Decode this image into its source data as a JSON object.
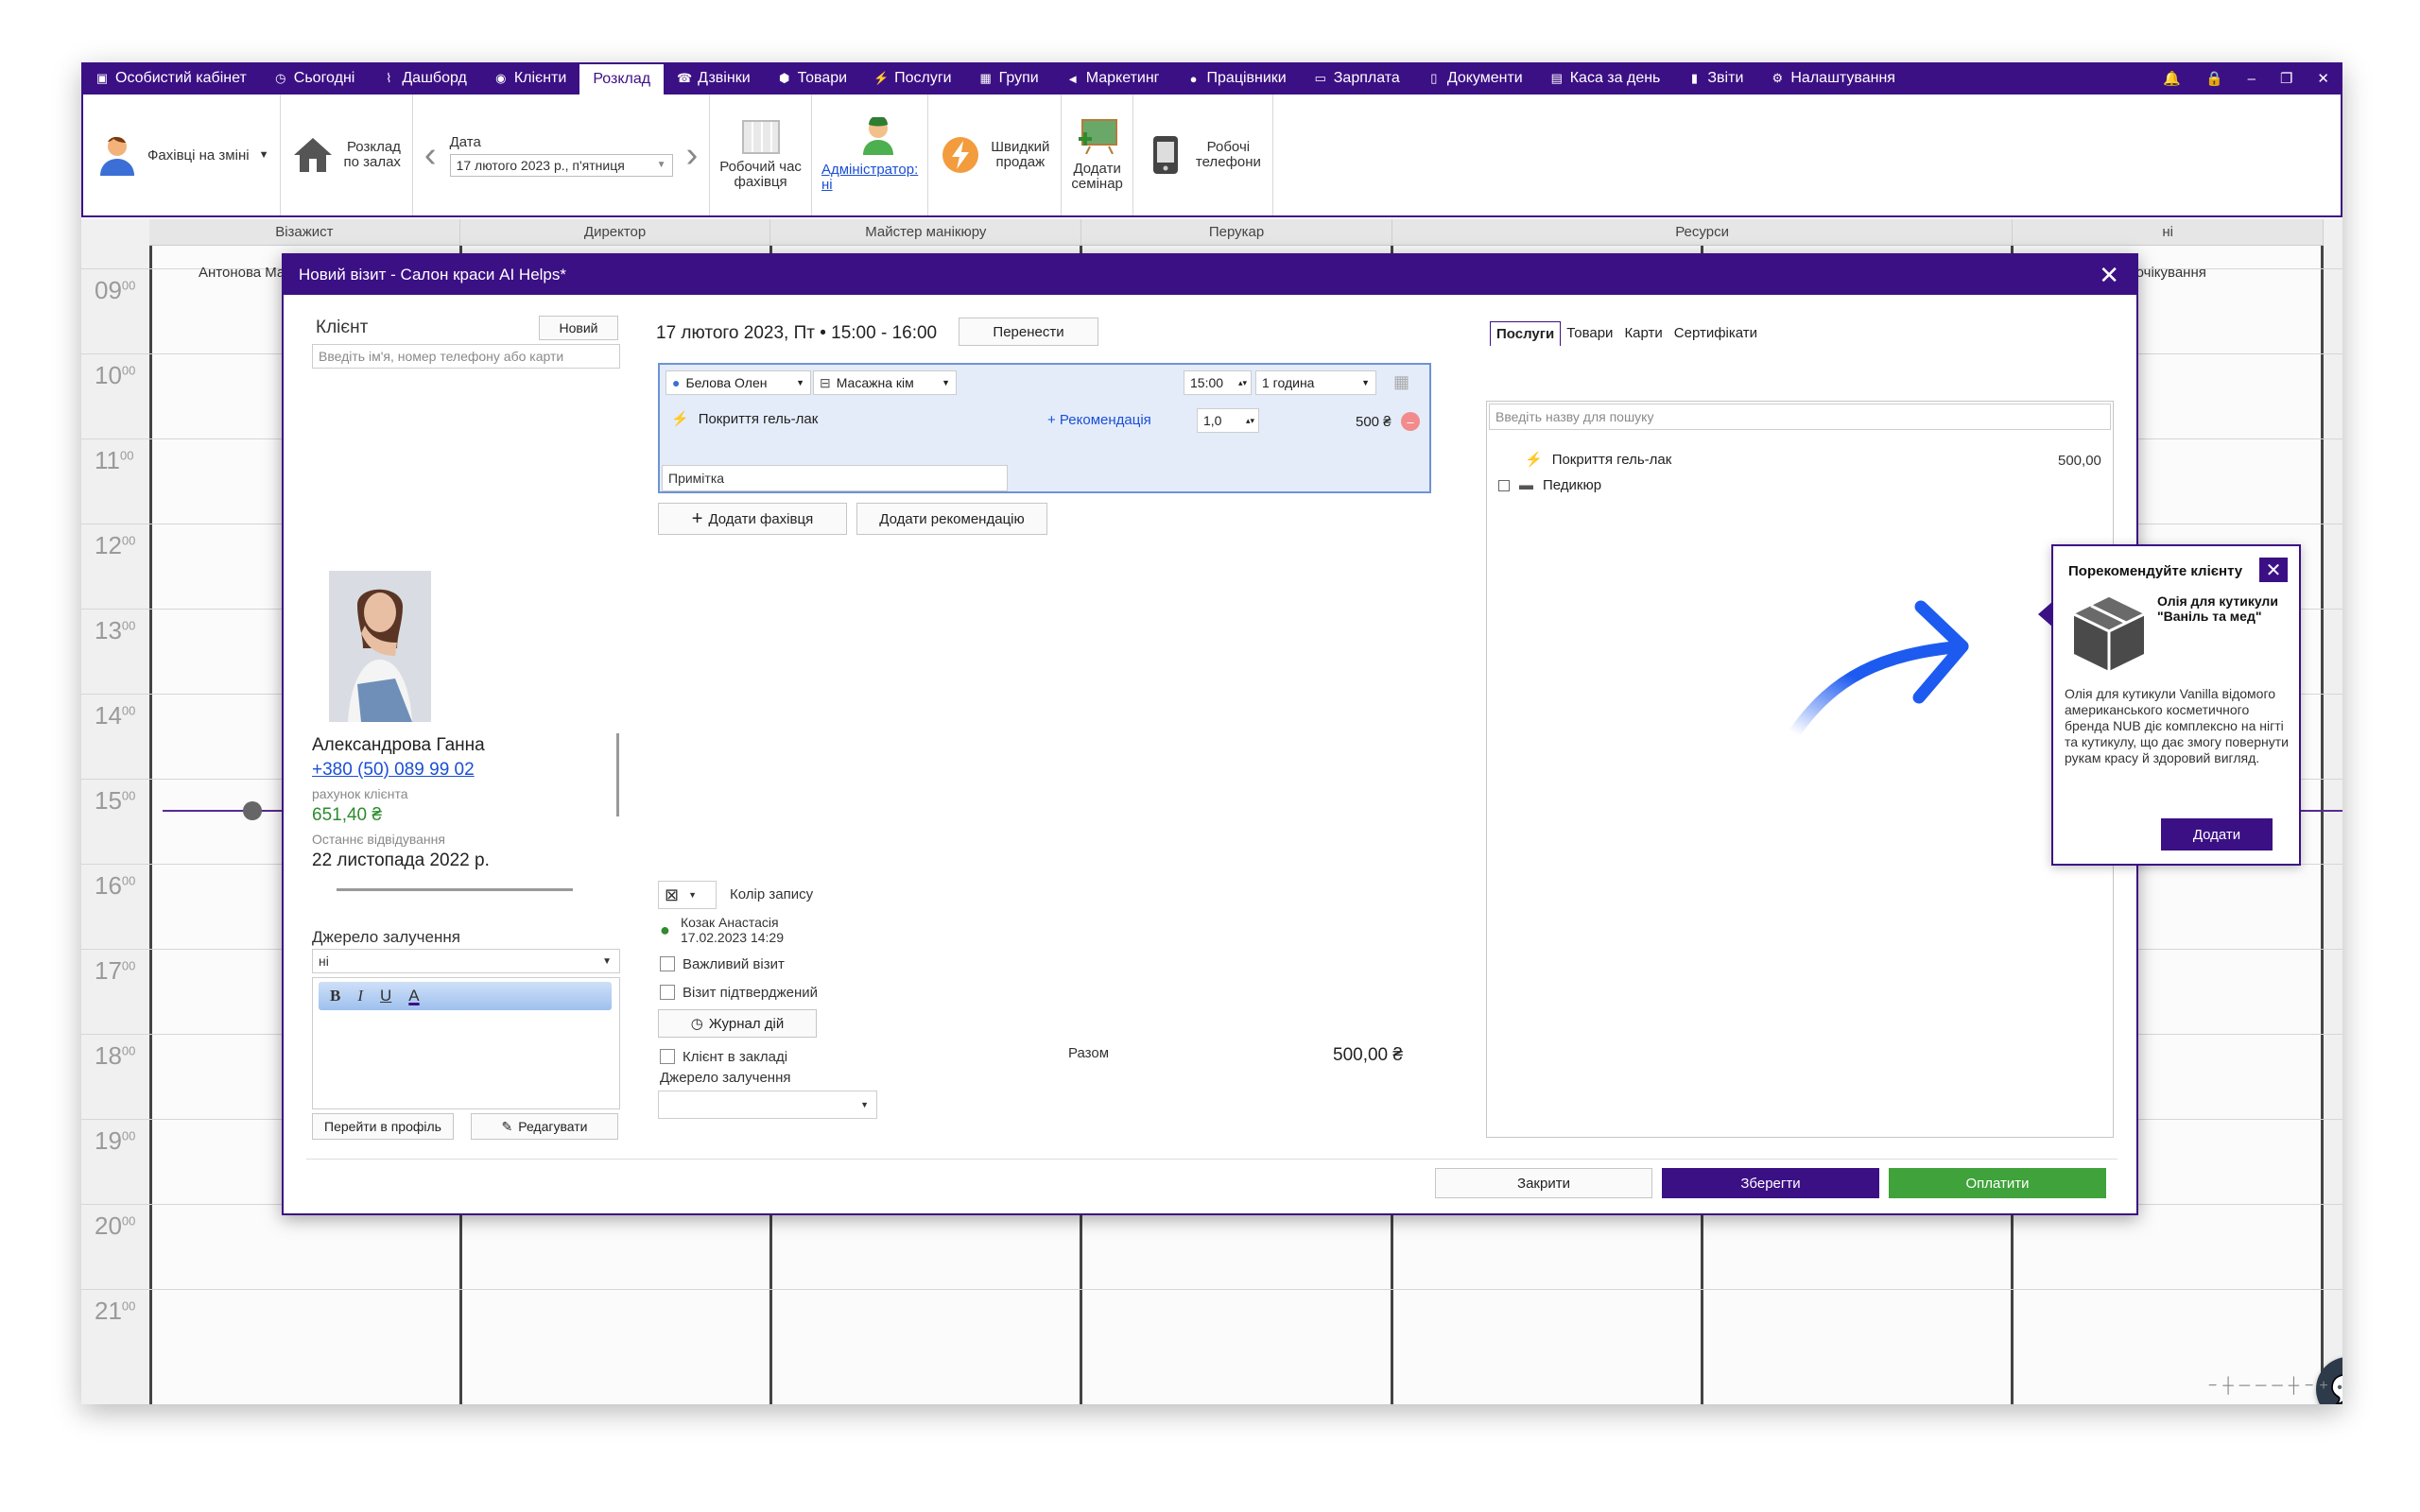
{
  "topnav": {
    "items": [
      {
        "label": "Особистий кабінет",
        "icon": "briefcase-icon"
      },
      {
        "label": "Сьогодні",
        "icon": "clock-icon"
      },
      {
        "label": "Дашборд",
        "icon": "pulse-icon"
      },
      {
        "label": "Клієнти",
        "icon": "user-circle-icon"
      },
      {
        "label": "Розклад",
        "icon": ""
      },
      {
        "label": "Дзвінки",
        "icon": "phone-icon"
      },
      {
        "label": "Товари",
        "icon": "box-icon"
      },
      {
        "label": "Послуги",
        "icon": "lightning-icon"
      },
      {
        "label": "Групи",
        "icon": "group-icon"
      },
      {
        "label": "Маркетинг",
        "icon": "megaphone-icon"
      },
      {
        "label": "Працівники",
        "icon": "person-icon"
      },
      {
        "label": "Зарплата",
        "icon": "money-icon"
      },
      {
        "label": "Документи",
        "icon": "document-icon"
      },
      {
        "label": "Каса за день",
        "icon": "calculator-icon"
      },
      {
        "label": "Звіти",
        "icon": "bar-chart-icon"
      },
      {
        "label": "Налаштування",
        "icon": "gear-icon"
      }
    ],
    "active_index": 4
  },
  "ribbon": {
    "staff_on_shift": "Фахівці на зміні",
    "schedule_by_halls": "Розклад\nпо залах",
    "date_label": "Дата",
    "date_value": "17 лютого 2023 р., п'ятниця",
    "specialist_worktime": "Робочий час\nфахівця",
    "admin_label": "Адміністратор:",
    "admin_value": "ні",
    "quick_sale": "Швидкий\nпродаж",
    "add_seminar": "Додати\nсемінар",
    "work_phones": "Робочі\nтелефони"
  },
  "calendar": {
    "columns": [
      "Візажист",
      "Директор",
      "Майстер манікюру",
      "Перукар",
      "Ресурси",
      "ні"
    ],
    "subheader_left": "Антонова Ма",
    "subheader_right": "г очікування",
    "hours": [
      "09",
      "10",
      "11",
      "12",
      "13",
      "14",
      "15",
      "16",
      "17",
      "18",
      "19",
      "20",
      "21"
    ]
  },
  "dialog": {
    "title": "Новий візит - Салон краси AI Helps*",
    "client_label": "Клієнт",
    "new_button": "Новий",
    "client_search_placeholder": "Введіть ім'я, номер телефону або карти",
    "visit_datetime": "17 лютого 2023, Пт • 15:00 - 16:00",
    "move_button": "Перенести",
    "specialist": "Белова Олен",
    "room": "Масажна кім",
    "time": "15:00",
    "duration": "1 година",
    "service_name": "Покриття гель-лак",
    "recommendation_link": "+ Рекомендація",
    "quantity": "1,0",
    "service_price": "500 ₴",
    "note_placeholder": "Примітка",
    "add_specialist_button": "Додати фахівця",
    "add_recommendation_button": "Додати рекомендацію",
    "client_name": "Александрова Ганна",
    "client_phone": "+380 (50) 089 99 02",
    "account_label": "рахунок клієнта",
    "account_value": "651,40 ₴",
    "last_visit_label": "Останнє відвідування",
    "last_visit_value": "22 листопада 2022 р.",
    "source_label": "Джерело залучення",
    "source_value": "ні",
    "rt_bold": "B",
    "rt_italic": "I",
    "rt_underline": "U",
    "rt_color": "A",
    "go_profile_button": "Перейти в профіль",
    "edit_button": "Редагувати",
    "record_color_label": "Колір запису",
    "creator_name": "Козак Анастасія",
    "creator_date": "17.02.2023 14:29",
    "important_visit": "Важливий візит",
    "visit_confirmed": "Візит підтверджений",
    "action_log_button": "Журнал дій",
    "client_in_salon": "Клієнт в закладі",
    "source_label2": "Джерело залучення",
    "total_label": "Разом",
    "total_value": "500,00 ₴",
    "right_tabs": [
      "Послуги",
      "Товари",
      "Карти",
      "Сертифікати"
    ],
    "right_search_placeholder": "Введіть назву для пошуку",
    "right_items": [
      {
        "name": "Покриття гель-лак",
        "price": "500,00"
      },
      {
        "name": "Педикюр",
        "price": ""
      }
    ],
    "close_button": "Закрити",
    "save_button": "Зберегти",
    "pay_button": "Оплатити"
  },
  "popup": {
    "title": "Порекомендуйте клієнту",
    "product_name": "Олія для кутикули \"Ваніль та мед\"",
    "description": "Олія для кутикули Vanilla відомого американського косметичного бренда NUB діє комплексно на нігті та кутикулу, що дає змогу повернути рукам красу й здоровий вигляд.",
    "add_button": "Додати"
  },
  "colors": {
    "brand": "#3c1085",
    "pay": "#3fa23a",
    "arrow": "#1d5bf0",
    "balance": "#2e8b2e"
  }
}
